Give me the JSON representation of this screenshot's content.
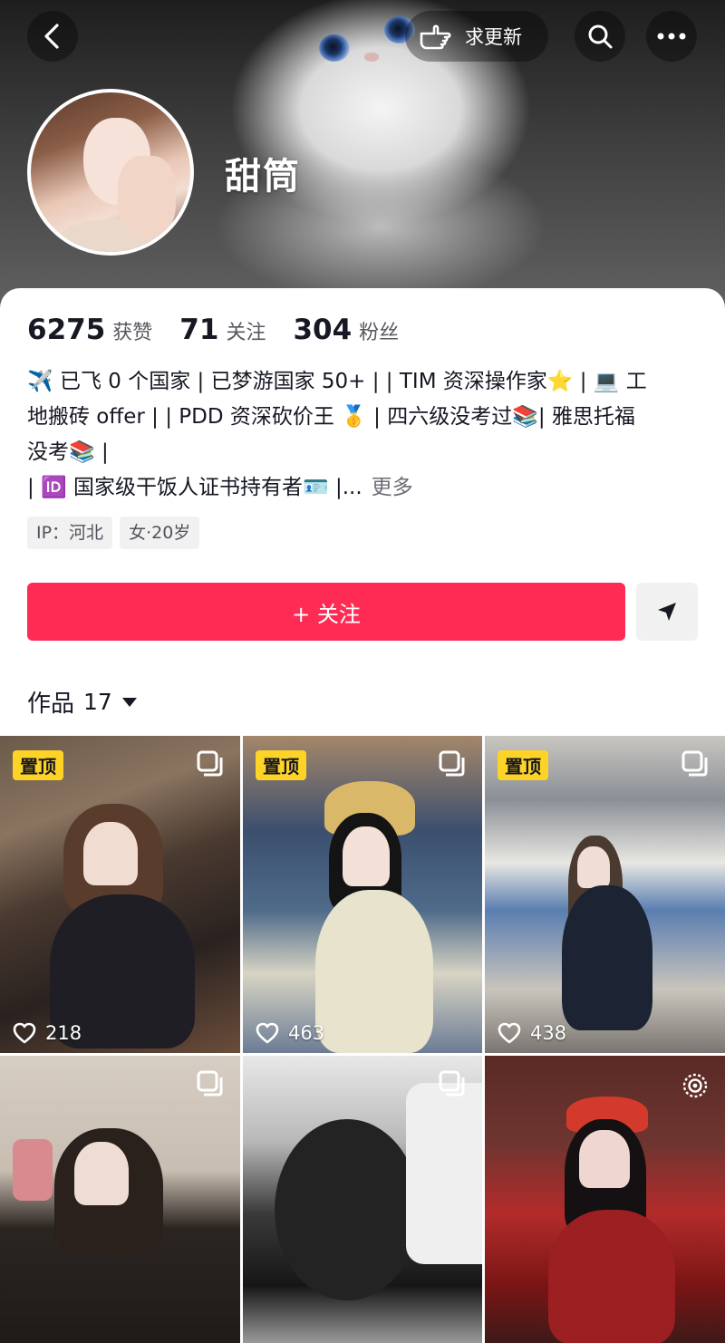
{
  "header": {
    "request_update_label": "求更新",
    "username": "甜筒"
  },
  "stats": [
    {
      "num": "6275",
      "label": "获赞"
    },
    {
      "num": "71",
      "label": "关注"
    },
    {
      "num": "304",
      "label": "粉丝"
    }
  ],
  "bio": {
    "lines": [
      "✈️ 已飞 0 个国家 | 已梦游国家 50+ |  | TIM 资深操作家⭐ | 💻 工",
      "地搬砖 offer  | | PDD 资深砍价王 🥇 | 四六级没考过📚| 雅思托福",
      "没考📚 |",
      " | 🆔 国家级干饭人证书持有者🪪 |..."
    ],
    "more": "更多"
  },
  "tags": [
    "IP：河北",
    "女·20岁"
  ],
  "actions": {
    "follow_label": "+ 关注"
  },
  "works": {
    "label": "作品",
    "count": "17"
  },
  "posts": [
    {
      "pinned": "置顶",
      "likes": "218"
    },
    {
      "pinned": "置顶",
      "likes": "463"
    },
    {
      "pinned": "置顶",
      "likes": "438"
    },
    {
      "pinned": "",
      "likes": ""
    },
    {
      "pinned": "",
      "likes": ""
    },
    {
      "pinned": "",
      "likes": ""
    }
  ],
  "colors": {
    "accent": "#fe2c55",
    "pin_badge": "#fdd327"
  }
}
